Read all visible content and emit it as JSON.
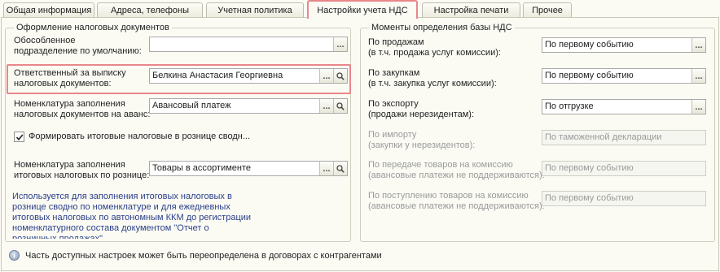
{
  "tabs": [
    {
      "label": "Общая информация"
    },
    {
      "label": "Адреса, телефоны"
    },
    {
      "label": "Учетная политика"
    },
    {
      "label": "Настройки учета НДС"
    },
    {
      "label": "Настройка печати"
    },
    {
      "label": "Прочее"
    }
  ],
  "left_group": {
    "title": "Оформление налоговых документов",
    "separate_unit": {
      "label": "Обособленное\nподразделение по умолчанию:",
      "value": ""
    },
    "responsible": {
      "label": "Ответственный за выписку\nналоговых документов:",
      "value": "Белкина Анастасия Георгиевна"
    },
    "advance_nomenclature": {
      "label": "Номенклатура заполнения\nналоговых документов на аванс:",
      "value": "Авансовый платеж"
    },
    "retail_summary_checkbox": {
      "label": "Формировать итоговые налоговые в рознице сводн...",
      "checked": true
    },
    "retail_nomenclature": {
      "label": "Номенклатура заполнения\nитоговых налоговых по рознице:",
      "value": "Товары в ассортименте"
    },
    "note": "Используется для заполнения итоговых налоговых в\nрознице сводно по номенклатуре и для ежедневных\nитоговых налоговых по автономным ККМ до регистрации\nноменклатурного состава документом \"Отчет о\nрозничных продажах\""
  },
  "right_group": {
    "title": "Моменты определения базы НДС",
    "rows": [
      {
        "label": "По продажам\n(в т.ч. продажа услуг комиссии):",
        "value": "По первому событию",
        "disabled": false
      },
      {
        "label": "По закупкам\n(в т.ч. закупка услуг комиссии):",
        "value": "По первому событию",
        "disabled": false
      },
      {
        "label": "По экспорту\n(продажи нерезидентам):",
        "value": "По отгрузке",
        "disabled": false
      },
      {
        "label": "По импорту\n(закупки у нерезидентов):",
        "value": "По таможенной декларации",
        "disabled": true
      },
      {
        "label": "По передаче товаров на комиссию\n(авансовые платежи не поддерживаются):",
        "value": "По первому событию",
        "disabled": true
      },
      {
        "label": "По поступлению товаров на комиссию\n(авансовые платежи не поддерживаются):",
        "value": "По первому событию",
        "disabled": true
      }
    ]
  },
  "footer": {
    "info_text": "Часть доступных настроек может быть переопределена в договорах с контрагентами"
  },
  "colors": {
    "highlight": "#e8878a",
    "note_text": "#2a3f88",
    "disabled_text": "#9a9a9a"
  }
}
